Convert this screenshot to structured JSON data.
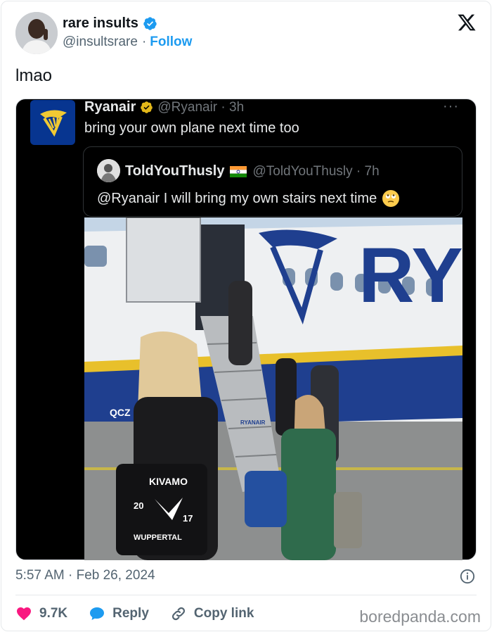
{
  "author": {
    "name": "rare insults",
    "handle": "@insultsrare",
    "separator": "·",
    "follow_label": "Follow"
  },
  "tweet": {
    "text": "lmao",
    "timestamp": "5:57 AM · Feb 26, 2024"
  },
  "embedded": {
    "reply": {
      "name": "Ryanair",
      "meta": "@Ryanair · 3h",
      "text": "bring your own plane next time too",
      "more": "···"
    },
    "quoted": {
      "name": "ToldYouThusly",
      "meta": "@ToldYouThusly · 7h",
      "text": "@Ryanair I will bring my own stairs next time"
    },
    "photo": {
      "plane_text": "RY",
      "reg": "QCZ",
      "stair_brand": "RYANAIR",
      "bag_text_top": "KIVAMO",
      "bag_text_left": "20",
      "bag_text_right": "17",
      "bag_text_bottom": "WUPPERTAL"
    }
  },
  "actions": {
    "likes": "9.7K",
    "reply_label": "Reply",
    "copy_label": "Copy link"
  },
  "watermark": "boredpanda.com",
  "colors": {
    "link": "#1d9bf0",
    "like": "#f91880",
    "ryanair_blue": "#073590",
    "ryanair_yellow": "#f1c933"
  }
}
